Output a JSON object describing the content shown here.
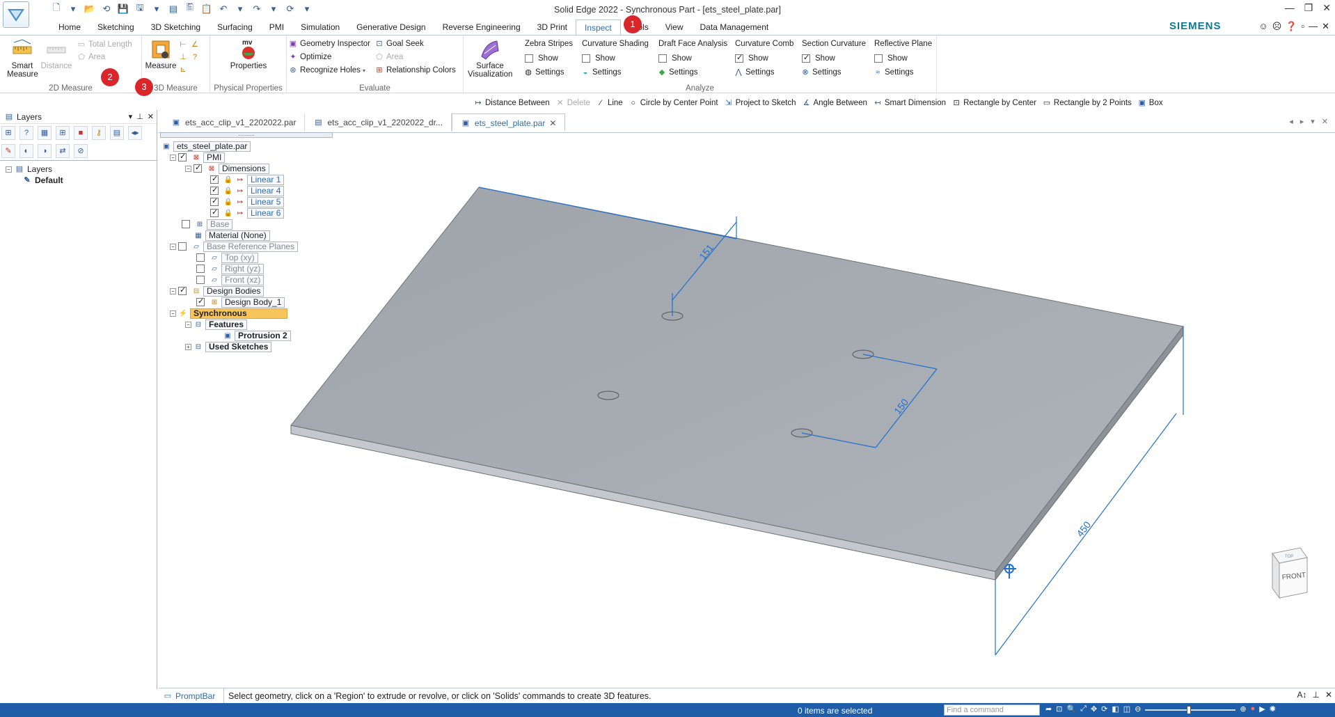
{
  "window": {
    "title": "Solid Edge 2022 - Synchronous Part - [ets_steel_plate.par]",
    "brand": "SIEMENS",
    "controls": [
      "—",
      "❐",
      "✕"
    ]
  },
  "qat": [
    "🗋",
    "▾",
    "📂",
    "⟲",
    "💾",
    "🖫",
    "▾",
    "▤",
    "🖺",
    "📋",
    "↶",
    "▾",
    "↷",
    "▾",
    "⟳",
    "▾"
  ],
  "ribbon_tabs": [
    "Home",
    "Sketching",
    "3D Sketching",
    "Surfacing",
    "PMI",
    "Simulation",
    "Generative Design",
    "Reverse Engineering",
    "3D Print",
    "Inspect",
    "Tools",
    "View",
    "Data Management"
  ],
  "active_tab": "Inspect",
  "ribbon": {
    "measure2d": {
      "label": "2D Measure",
      "smart_measure": "Smart\nMeasure",
      "distance": "Distance",
      "total_length": "Total Length",
      "area": "Area"
    },
    "measure3d": {
      "label": "3D Measure",
      "measure": "Measure"
    },
    "physical": {
      "label": "Physical Properties",
      "properties": "Properties",
      "icon_text": "mv"
    },
    "evaluate": {
      "label": "Evaluate",
      "geometry_inspector": "Geometry Inspector",
      "optimize": "Optimize",
      "recognize_holes": "Recognize Holes",
      "goal_seek": "Goal Seek",
      "area": "Area",
      "relationship_colors": "Relationship Colors"
    },
    "analyze": {
      "label": "Analyze",
      "surface_visualization": "Surface\nVisualization",
      "columns": [
        {
          "title": "Zebra Stripes",
          "show": "Show",
          "checked": false,
          "settings": "Settings"
        },
        {
          "title": "Curvature Shading",
          "show": "Show",
          "checked": false,
          "settings": "Settings"
        },
        {
          "title": "Draft Face Analysis",
          "show": "Show",
          "checked": false,
          "settings": "Settings"
        },
        {
          "title": "Curvature Comb",
          "show": "Show",
          "checked": true,
          "settings": "Settings"
        },
        {
          "title": "Section Curvature",
          "show": "Show",
          "checked": true,
          "settings": "Settings"
        },
        {
          "title": "Reflective Plane",
          "show": "Show",
          "checked": false,
          "settings": "Settings"
        }
      ]
    }
  },
  "badges": [
    "1",
    "2",
    "3"
  ],
  "command_bar": [
    "Distance Between",
    "Delete",
    "Line",
    "Circle by Center Point",
    "Project to Sketch",
    "Angle Between",
    "Smart Dimension",
    "Rectangle by Center",
    "Rectangle by 2 Points",
    "Box"
  ],
  "left_pane": {
    "title": "Layers",
    "tree_root": "Layers",
    "tree_child": "Default"
  },
  "doc_tabs": [
    "ets_acc_clip_v1_2202022.par",
    "ets_acc_clip_v1_2202022_dr...",
    "ets_steel_plate.par"
  ],
  "pathfinder": {
    "root": "ets_steel_plate.par",
    "pmi": "PMI",
    "dimensions": "Dimensions",
    "linears": [
      "Linear 1",
      "Linear 4",
      "Linear 5",
      "Linear 6"
    ],
    "base": "Base",
    "material": "Material (None)",
    "base_ref_planes": "Base Reference Planes",
    "planes": [
      "Top (xy)",
      "Right (yz)",
      "Front (xz)"
    ],
    "design_bodies": "Design Bodies",
    "design_body_1": "Design Body_1",
    "synchronous": "Synchronous",
    "features": "Features",
    "protrusion": "Protrusion 2",
    "used_sketches": "Used Sketches"
  },
  "dimensions": {
    "d1": "151",
    "d2": "150",
    "d3": "450"
  },
  "viewcube": {
    "face": "FRONT",
    "top": "TOP"
  },
  "promptbar": {
    "label": "PromptBar",
    "text": "Select geometry, click on a 'Region' to extrude or revolve, or click on 'Solids' commands to create 3D features."
  },
  "status": {
    "selection": "0 items are selected",
    "find_placeholder": "Find a command"
  },
  "colors": {
    "accent": "#2b6cb3",
    "status_bar": "#1f5da8",
    "badge": "#d9262b",
    "plate": "#a7adb3",
    "dimension": "#1f6fd0"
  }
}
